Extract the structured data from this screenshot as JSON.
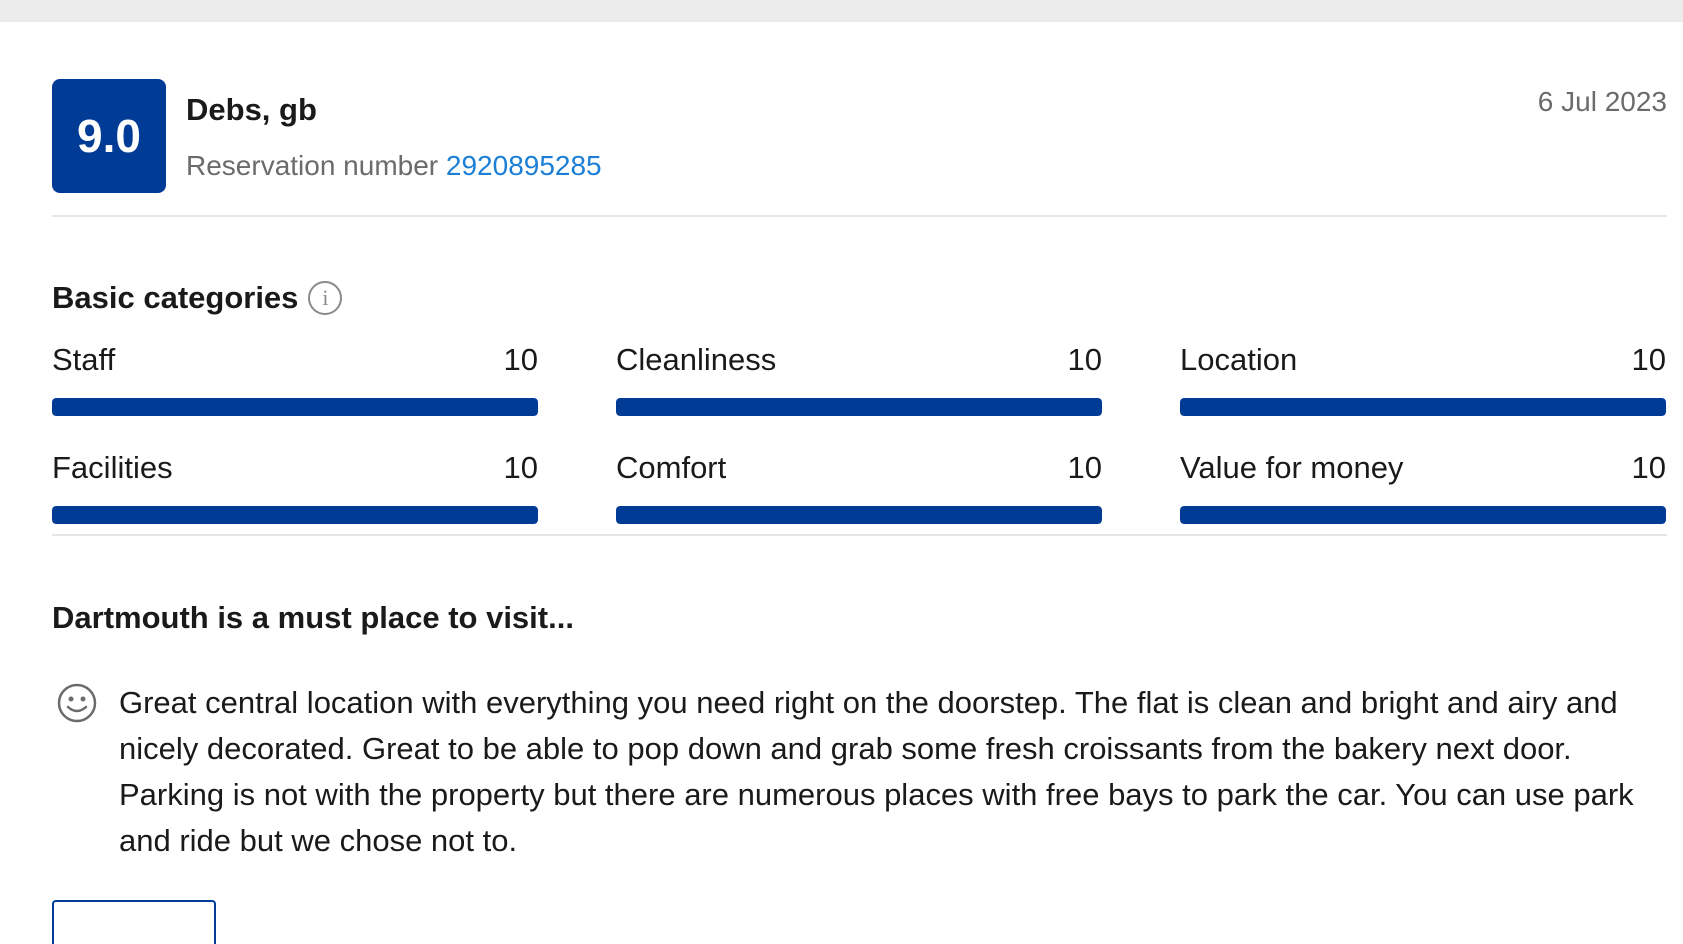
{
  "review": {
    "score": "9.0",
    "reviewer": "Debs, gb",
    "reservation_label": "Reservation number",
    "reservation_number": "2920895285",
    "date": "6 Jul 2023"
  },
  "categories": {
    "heading": "Basic categories",
    "items": [
      {
        "label": "Staff",
        "value": "10",
        "fill": 1.0
      },
      {
        "label": "Cleanliness",
        "value": "10",
        "fill": 1.0
      },
      {
        "label": "Location",
        "value": "10",
        "fill": 1.0
      },
      {
        "label": "Facilities",
        "value": "10",
        "fill": 1.0
      },
      {
        "label": "Comfort",
        "value": "10",
        "fill": 1.0
      },
      {
        "label": "Value for money",
        "value": "10",
        "fill": 1.0
      }
    ]
  },
  "review_body": {
    "title": "Dartmouth is a must place to visit...",
    "positive_text": "Great central location with everything you need right on the doorstep. The flat is clean and bright and airy and nicely decorated. Great to be able to pop down and grab some fresh croissants from the bakery next door. Parking is not with the property but there are numerous places with free bays to park the car. You can use park and ride but we chose not to.",
    "positive_icon": "smiley-face-icon"
  },
  "colors": {
    "brand": "#003b95",
    "link": "#1c7fd6",
    "muted": "#6b6b6b"
  }
}
